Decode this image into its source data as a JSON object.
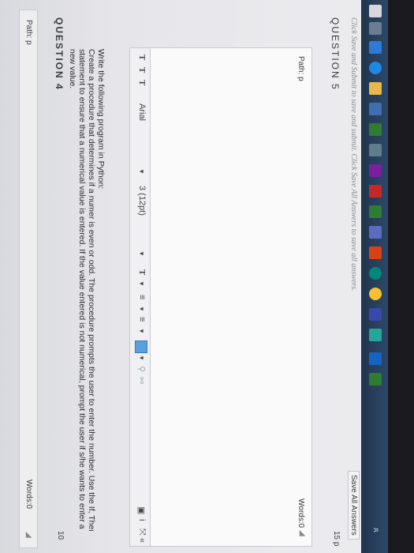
{
  "top_path": "Path: p",
  "top_words": "Words:0",
  "question4": {
    "title": "QUESTION 4",
    "points": "10",
    "prompt_lines": [
      "Write the following program in Python:",
      "Create a procedure that determines if a numer is even or odd. The procedure prompts the user to enter the number. Use the If, Then",
      "statement to ensure that a numerical value is entered. If the value entered is not numerical, prompt the user if s/he wants to enter a",
      "new value."
    ]
  },
  "toolbar": {
    "format_t1": "T",
    "format_t2": "T",
    "format_t3": "T",
    "font_family": "Arial",
    "font_size": "3 (12pt)",
    "text_color_label": "T",
    "list_bullets": "≡",
    "list_numbers": "≡"
  },
  "editor": {
    "path": "Path: p",
    "words": "Words:0"
  },
  "question5": {
    "title": "QUESTION 5",
    "points": "15 p"
  },
  "footer": {
    "instruction": "Click Save and Submit to save and submit. Click Save All Answers to save all answers.",
    "save_all_label": "Save All Answers"
  },
  "colors": {
    "taskbar": "#2a3f5c",
    "accent": "#2d7bd6"
  }
}
